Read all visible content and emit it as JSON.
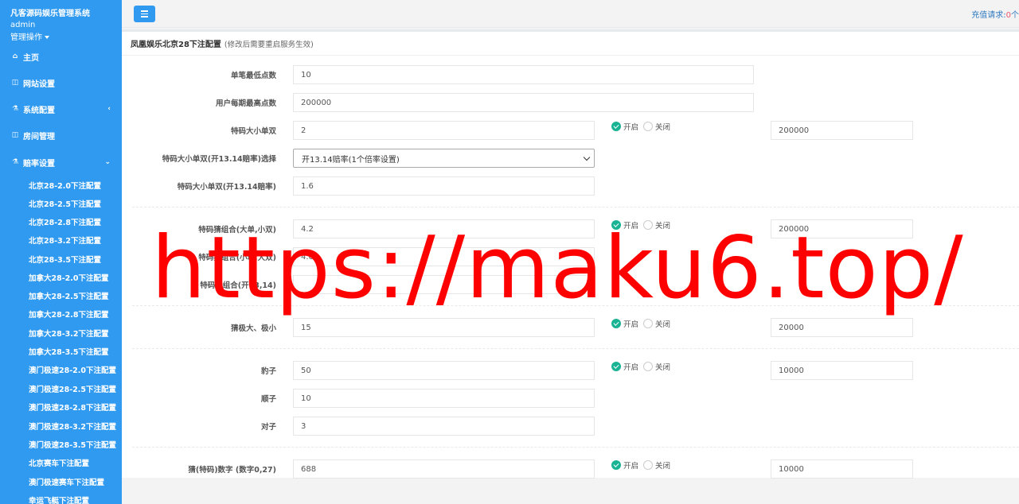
{
  "sidebar": {
    "brand": "凡客源码娱乐管理系统",
    "user": "admin",
    "manage_label": "管理操作",
    "nav": [
      {
        "label": "主页",
        "icon": "home-icon"
      },
      {
        "label": "网站设置",
        "icon": "columns-icon"
      },
      {
        "label": "系统配置",
        "icon": "flask-icon"
      },
      {
        "label": "房间管理",
        "icon": "columns-icon"
      },
      {
        "label": "赔率设置",
        "icon": "flask-icon"
      }
    ],
    "sub_items": [
      "北京28-2.0下注配置",
      "北京28-2.5下注配置",
      "北京28-2.8下注配置",
      "北京28-3.2下注配置",
      "北京28-3.5下注配置",
      "加拿大28-2.0下注配置",
      "加拿大28-2.5下注配置",
      "加拿大28-2.8下注配置",
      "加拿大28-3.2下注配置",
      "加拿大28-3.5下注配置",
      "澳门极速28-2.0下注配置",
      "澳门极速28-2.5下注配置",
      "澳门极速28-2.8下注配置",
      "澳门极速28-3.2下注配置",
      "澳门极速28-3.5下注配置",
      "北京赛车下注配置",
      "澳门极速赛车下注配置",
      "幸运飞艇下注配置"
    ]
  },
  "topbar": {
    "recharge_label": "充值请求:",
    "recharge_count": "0",
    "recharge_unit": "个"
  },
  "panel": {
    "title": "凤凰娱乐北京28下注配置",
    "hint": "(修改后需要重启服务生效)"
  },
  "radio": {
    "on": "开启",
    "off": "关闭"
  },
  "form": {
    "min_bet": {
      "label": "单笔最低点数",
      "value": "10"
    },
    "max_bet": {
      "label": "用户每期最高点数",
      "value": "200000"
    },
    "size_odd_even": {
      "label": "特码大小单双",
      "value": "2",
      "limit": "200000"
    },
    "select_1314": {
      "label": "特码大小单双(开13.14赔率)选择",
      "value": "开13.14赔率(1个倍率设置)"
    },
    "odds_1314": {
      "label": "特码大小单双(开13.14赔率)",
      "value": "1.6"
    },
    "combo1": {
      "label": "特码猜组合(大单,小双)",
      "value": "4.2",
      "limit": "200000"
    },
    "combo2": {
      "label": "特码猜组合(小单,大双)",
      "value": "4.6"
    },
    "combo3": {
      "label": "特码猜组合(开13,14)",
      "value": ""
    },
    "extreme": {
      "label": "猜极大、极小",
      "value": "15",
      "limit": "20000"
    },
    "leopard": {
      "label": "豹子",
      "value": "50",
      "limit": "10000"
    },
    "straight": {
      "label": "顺子",
      "value": "10"
    },
    "pair": {
      "label": "对子",
      "value": "3"
    },
    "number": {
      "label": "猜(特码)数字 (数字0,27)",
      "value": "688",
      "limit": "10000"
    }
  },
  "watermark": "https://maku6.top/"
}
